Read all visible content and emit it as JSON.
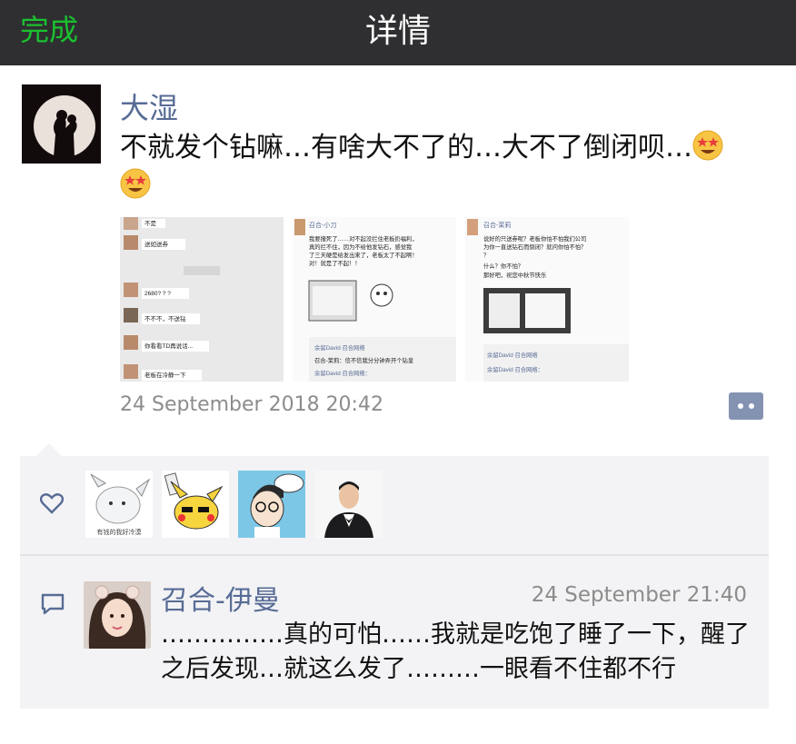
{
  "navbar": {
    "back_label": "完成",
    "title": "详情"
  },
  "post": {
    "author": "大湿",
    "text": "不就发个钻嘛…有啥大不了的…大不了倒闭呗…",
    "emoji_icon": "star-eyes-emoji",
    "timestamp": "24 September 2018 20:42",
    "photos": [
      {
        "lines": [
          "不是",
          "送如送券",
          "2680? ? ?",
          "不不不，不送钻",
          "你看看TD再说话...",
          "老板在冷静一下"
        ]
      },
      {
        "header": "召合-小刀",
        "lines": [
          "我要撞死了……对不起没拦住老板扔福利，",
          "真的拦不住，因为不给他发钻石，感觉我",
          "了三天硬是给发出来了，老板太了不起啊！",
          "对！就是了不起！！"
        ],
        "footer": [
          "余留David 召合网络",
          "召合-茉莉：信不信我分分钟弄开个钻皇",
          "余留David 召合网络："
        ]
      },
      {
        "header": "召合-茉莉",
        "lines": [
          "说好的只送券呢？老板你怕不怕我们公司",
          "为你一直送钻石而倒闭？就问你怕不怕？",
          "？",
          "什么？你不怕？",
          "那好吧，祝您中秋节快乐"
        ],
        "footer": [
          "余留David 召合网络",
          "余留David 召合网络："
        ]
      }
    ]
  },
  "likes": {
    "icon": "heart-icon",
    "avatars": [
      "like-avatar-rabbit",
      "like-avatar-pikachu",
      "like-avatar-cartoon-boy",
      "like-avatar-man-in-suit"
    ],
    "rabbit_caption": "有钱的我好冷漠"
  },
  "comments": [
    {
      "author": "召合-伊曼",
      "time": "24 September   21:40",
      "text": "……………真的可怕……我就是吃饱了睡了一下，醒了之后发现…就这么发了………一眼看不住都不行"
    }
  ],
  "colors": {
    "navbar_bg": "#2f2f32",
    "accent_green": "#1bc12f",
    "link_blue": "#576b95",
    "panel_bg": "#f3f3f5",
    "meta_gray": "#8c8c8c"
  }
}
